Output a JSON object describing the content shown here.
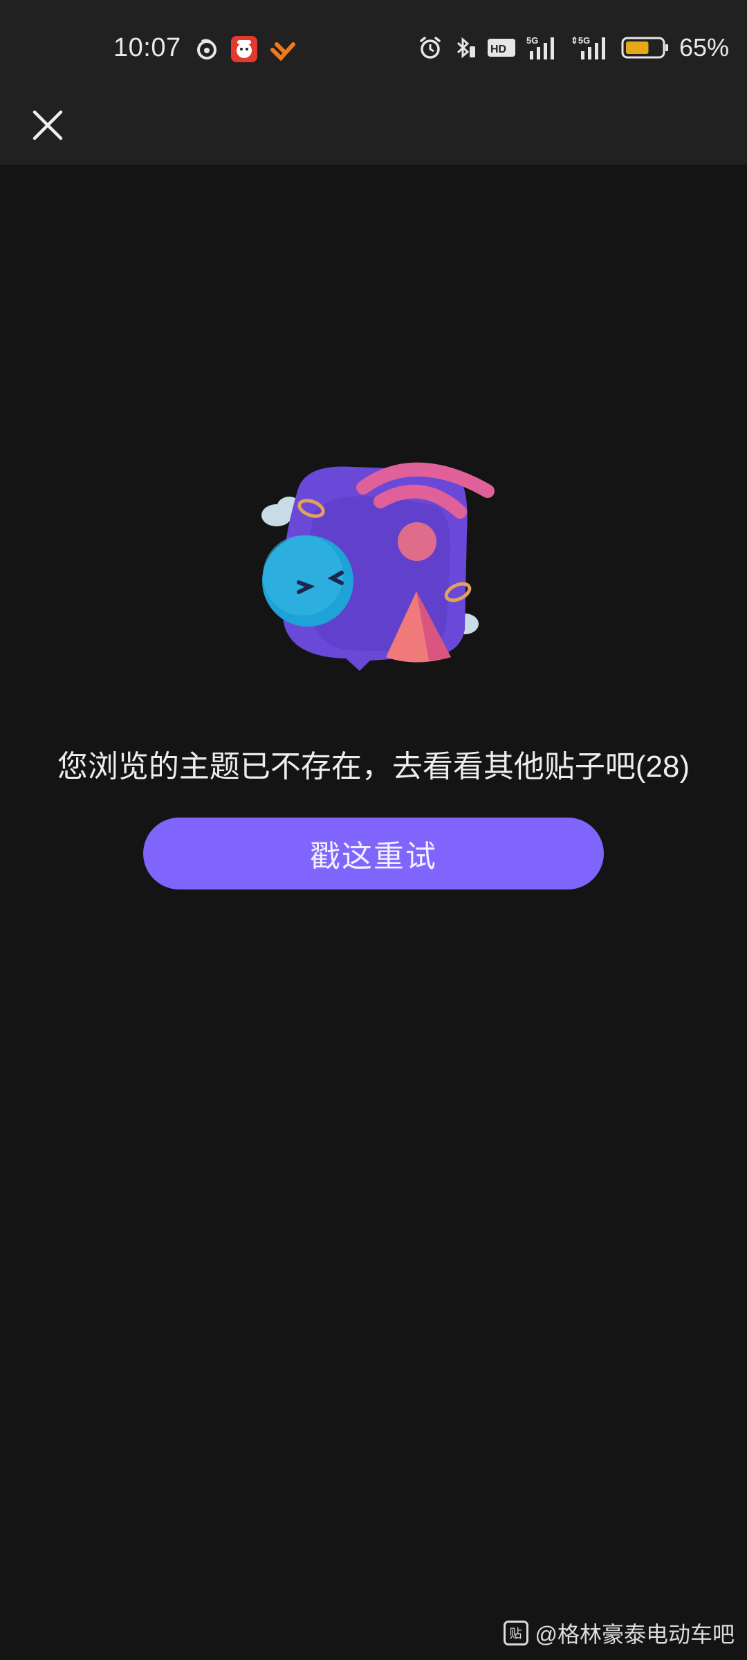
{
  "status_bar": {
    "time": "10:07",
    "left_icons": [
      "swirl-app-icon",
      "red-avatar-app-icon",
      "orange-heart-app-icon"
    ],
    "right_icons": [
      "alarm-icon",
      "bluetooth-icon",
      "hd-icon",
      "5g-signal-icon",
      "5g-signal-icon-2",
      "battery-icon"
    ],
    "battery_percent": "65%",
    "battery_level": 0.65,
    "battery_color": "#e6a817"
  },
  "toolbar": {
    "close_icon": "close-icon"
  },
  "empty_state": {
    "message": "您浏览的主题已不存在，去看看其他贴子吧(28)",
    "retry_label": "戳这重试"
  },
  "watermark": {
    "logo_text": "贴",
    "text": "@格林豪泰电动车吧"
  },
  "colors": {
    "background": "#141414",
    "bar_background": "#212121",
    "accent": "#7f65fb"
  }
}
